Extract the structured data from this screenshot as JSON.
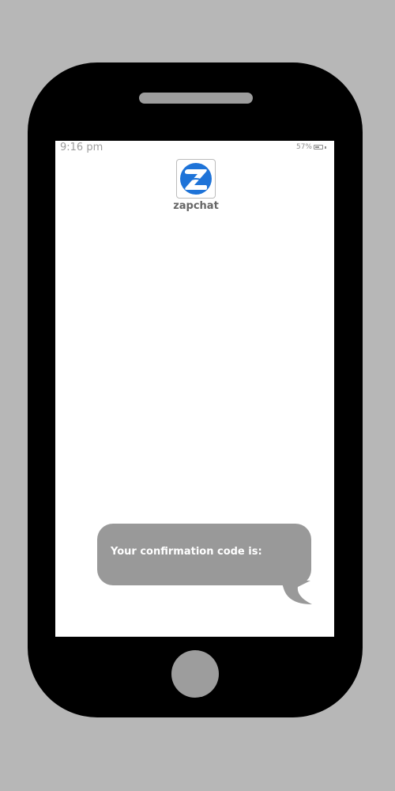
{
  "status_bar": {
    "time": "9:16 pm",
    "battery_percent": "57%",
    "battery_level": 0.57,
    "battery_icon": "battery-icon"
  },
  "app": {
    "name": "zapchat",
    "logo_icon": "zapchat-logo-icon",
    "logo_letter": "Z",
    "logo_color": "#1e73d8"
  },
  "message": {
    "text": "Your confirmation code is:"
  },
  "colors": {
    "background": "#b7b7b7",
    "phone_body": "#000000",
    "screen": "#ffffff",
    "bubble": "#999999",
    "hardware_button": "#9d9d9d"
  }
}
